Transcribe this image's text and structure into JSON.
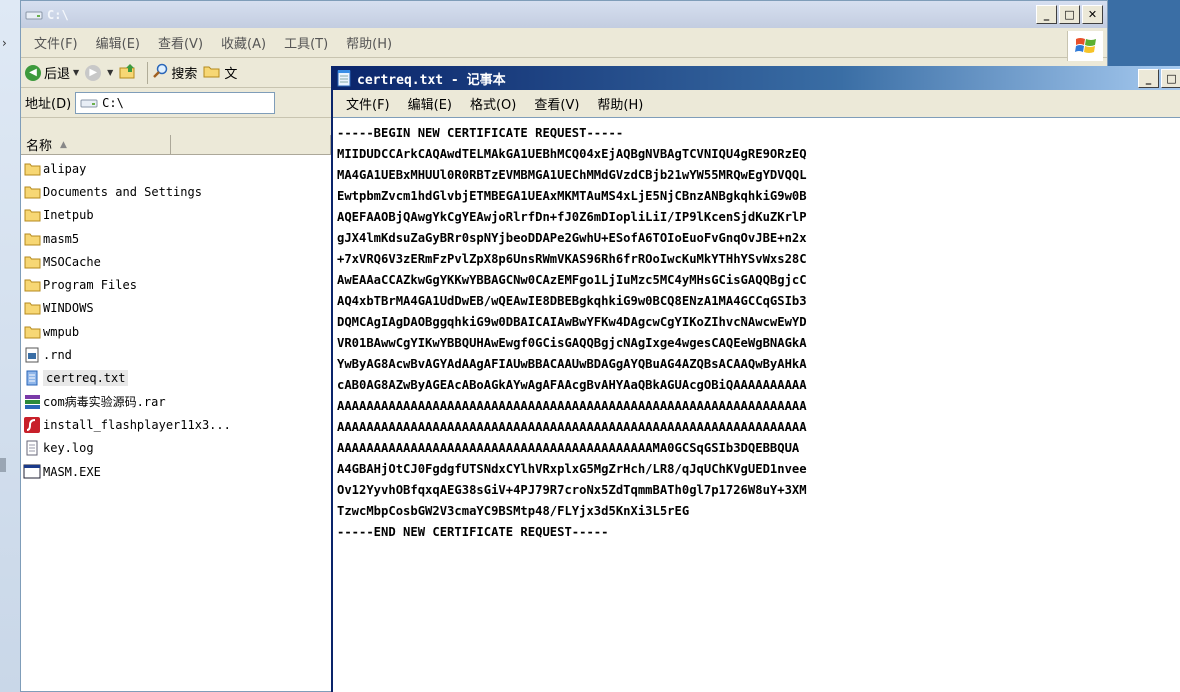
{
  "explorer": {
    "title": "C:\\",
    "menu": [
      "文件(F)",
      "编辑(E)",
      "查看(V)",
      "收藏(A)",
      "工具(T)",
      "帮助(H)"
    ],
    "toolbar": {
      "back_label": "后退",
      "search_label": "搜索",
      "folders_label": "文"
    },
    "address": {
      "label": "地址(D)",
      "value": "C:\\"
    },
    "columns": {
      "name": "名称"
    },
    "files": [
      {
        "name": "alipay",
        "icon": "folder-icon"
      },
      {
        "name": "Documents and Settings",
        "icon": "folder-icon"
      },
      {
        "name": "Inetpub",
        "icon": "folder-icon"
      },
      {
        "name": "masm5",
        "icon": "folder-icon"
      },
      {
        "name": "MSOCache",
        "icon": "folder-icon"
      },
      {
        "name": "Program Files",
        "icon": "folder-icon"
      },
      {
        "name": "WINDOWS",
        "icon": "folder-icon"
      },
      {
        "name": "wmpub",
        "icon": "folder-icon"
      },
      {
        "name": ".rnd",
        "icon": "file-icon"
      },
      {
        "name": "certreq.txt",
        "icon": "notepad-file-icon",
        "selected": true
      },
      {
        "name": "com病毒实验源码.rar",
        "icon": "rar-icon"
      },
      {
        "name": "install_flashplayer11x3...",
        "icon": "flash-icon"
      },
      {
        "name": "key.log",
        "icon": "text-file-icon"
      },
      {
        "name": "MASM.EXE",
        "icon": "exe-icon"
      }
    ]
  },
  "notepad": {
    "title": "certreq.txt - 记事本",
    "menu": [
      "文件(F)",
      "编辑(E)",
      "格式(O)",
      "查看(V)",
      "帮助(H)"
    ],
    "lines": [
      "-----BEGIN NEW CERTIFICATE REQUEST-----",
      "MIIDUDCCArkCAQAwdTELMAkGA1UEBhMCQ04xEjAQBgNVBAgTCVNIQU4gRE9ORzEQ",
      "MA4GA1UEBxMHUUl0R0RBTzEVMBMGA1UEChMMdGVzdCBjb21wYW55MRQwEgYDVQQL",
      "EwtpbmZvcm1hdGlvbjETMBEGA1UEAxMKMTAuMS4xLjE5NjCBnzANBgkqhkiG9w0B",
      "AQEFAAOBjQAwgYkCgYEAwjoRlrfDn+fJ0Z6mDIopliLiI/IP9lKcenSjdKuZKrlP",
      "gJX4lmKdsuZaGyBRr0spNYjbeoDDAPe2GwhU+ESofA6TOIoEuoFvGnqOvJBE+n2x",
      "+7xVRQ6V3zERmFzPvlZpX8p6UnsRWmVKAS96Rh6frROoIwcKuMkYTHhYSvWxs28C",
      "AwEAAaCCAZkwGgYKKwYBBAGCNw0CAzEMFgo1LjIuMzc5MC4yMHsGCisGAQQBgjcC",
      "AQ4xbTBrMA4GA1UdDwEB/wQEAwIE8DBEBgkqhkiG9w0BCQ8ENzA1MA4GCCqGSIb3",
      "DQMCAgIAgDAOBggqhkiG9w0DBAICAIAwBwYFKw4DAgcwCgYIKoZIhvcNAwcwEwYD",
      "VR01BAwwCgYIKwYBBQUHAwEwgf0GCisGAQQBgjcNAgIxge4wgesCAQEeWgBNAGkA",
      "YwByAG8AcwBvAGYAdAAgAFIAUwBBACAAUwBDAGgAYQBuAG4AZQBsACAAQwByAHkA",
      "cAB0AG8AZwByAGEAcABoAGkAYwAgAFAAcgBvAHYAaQBkAGUAcgOBiQAAAAAAAAAA",
      "AAAAAAAAAAAAAAAAAAAAAAAAAAAAAAAAAAAAAAAAAAAAAAAAAAAAAAAAAAAAAAAA",
      "AAAAAAAAAAAAAAAAAAAAAAAAAAAAAAAAAAAAAAAAAAAAAAAAAAAAAAAAAAAAAAAA",
      "AAAAAAAAAAAAAAAAAAAAAAAAAAAAAAAAAAAAAAAAAAAMA0GCSqGSIb3DQEBBQUA",
      "A4GBAHjOtCJ0FgdgfUTSNdxCYlhVRxplxG5MgZrHch/LR8/qJqUChKVgUED1nvee",
      "Ov12YyvhOBfqxqAEG38sGiV+4PJ79R7croNx5ZdTqmmBATh0gl7p1726W8uY+3XM",
      "TzwcMbpCosbGW2V3cmaYC9BSMtp48/FLYjx3d5KnXi3L5rEG",
      "-----END NEW CERTIFICATE REQUEST-----"
    ]
  },
  "window_buttons": {
    "minimize": "_",
    "maximize": "□",
    "close": "✕"
  },
  "colors": {
    "desktop": "#3a6ea5",
    "active_title": "#0a246a",
    "folder": "#f7d774"
  }
}
